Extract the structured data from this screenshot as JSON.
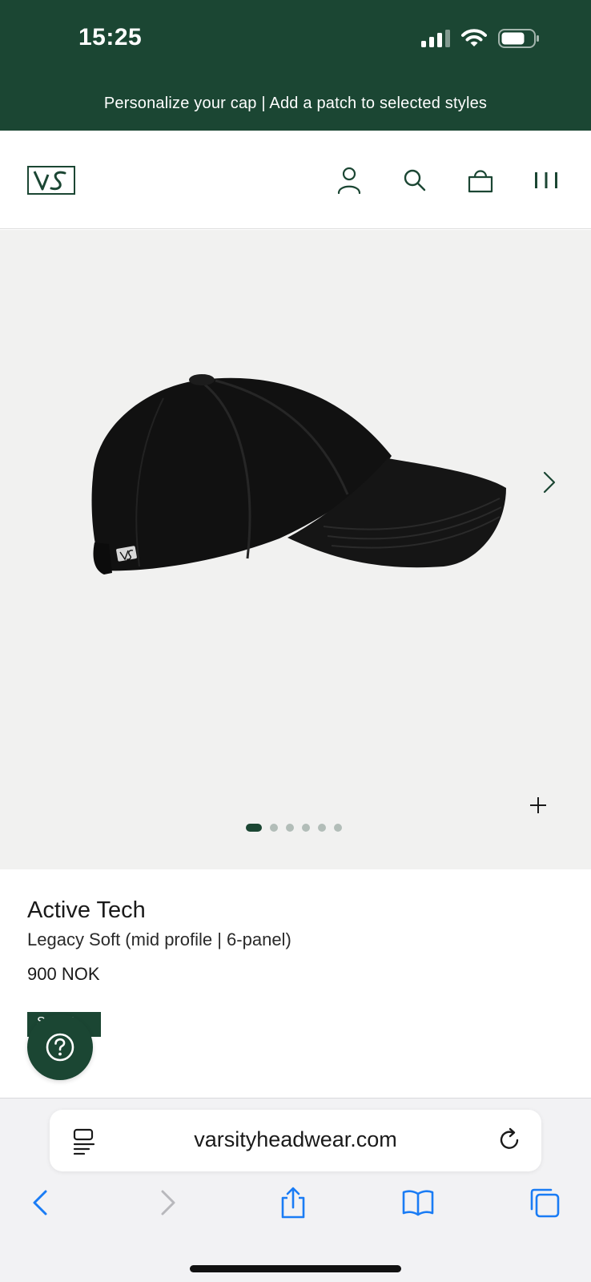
{
  "status_bar": {
    "time": "15:25",
    "signal_icon": "cellular-signal-icon",
    "wifi_icon": "wifi-icon",
    "battery_icon": "battery-icon"
  },
  "promo_banner": {
    "text": "Personalize your cap | Add a patch to selected styles"
  },
  "header": {
    "logo": "VS",
    "icons": [
      "account-icon",
      "search-icon",
      "bag-icon",
      "menu-icon"
    ]
  },
  "gallery": {
    "image": "black-cap-side-view",
    "total_images": 6,
    "active_index": 0,
    "next_icon": "chevron-right-icon",
    "zoom_icon": "plus-icon"
  },
  "product": {
    "name": "Active Tech",
    "model": "Legacy Soft (mid profile | 6-panel)",
    "price": "900 NOK",
    "badge": "SOFT"
  },
  "help_button": {
    "icon": "help-icon"
  },
  "browser": {
    "url": "varsityheadwear.com",
    "reader_icon": "reader-mode-icon",
    "reload_icon": "reload-icon",
    "toolbar": [
      "back-icon",
      "forward-icon",
      "share-icon",
      "bookmarks-icon",
      "tabs-icon"
    ]
  },
  "colors": {
    "brand_green": "#1b4633",
    "gallery_bg": "#f1f1f0",
    "ios_blue": "#1a7cf5"
  }
}
